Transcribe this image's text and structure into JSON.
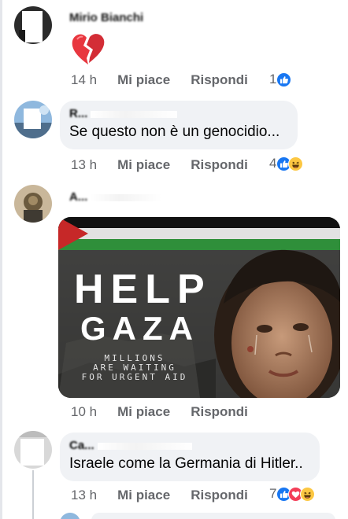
{
  "comments": [
    {
      "name": "Mirio Bianchi",
      "text": "",
      "emoji": "broken-heart",
      "time": "14 h",
      "like_label": "Mi piace",
      "reply_label": "Rispondi",
      "reaction_count": "1"
    },
    {
      "name": "R...",
      "text": "Se questo non è un genocidio...",
      "time": "13 h",
      "like_label": "Mi piace",
      "reply_label": "Rispondi",
      "reaction_count": "4"
    },
    {
      "name": "A...",
      "text": "",
      "image": {
        "title": "HELP",
        "subtitle": "GAZA",
        "line1": "MILLIONS",
        "line2": "ARE WAITING",
        "line3": "FOR URGENT AID"
      },
      "time": "10 h",
      "like_label": "Mi piace",
      "reply_label": "Rispondi"
    },
    {
      "name": "Ca...",
      "text": "Israele come la Germania di Hitler..",
      "time": "13 h",
      "like_label": "Mi piace",
      "reply_label": "Rispondi",
      "reaction_count": "7"
    }
  ],
  "colors": {
    "like_blue": "#1877f2",
    "love_red": "#f33e58",
    "haha_yellow": "#fcc742",
    "secondary_text": "#65676b",
    "bubble_bg": "#f0f2f5"
  },
  "icons": [
    "broken-heart-emoji",
    "like-reaction-icon",
    "haha-reaction-icon",
    "love-reaction-icon",
    "palestine-flag-icon"
  ]
}
